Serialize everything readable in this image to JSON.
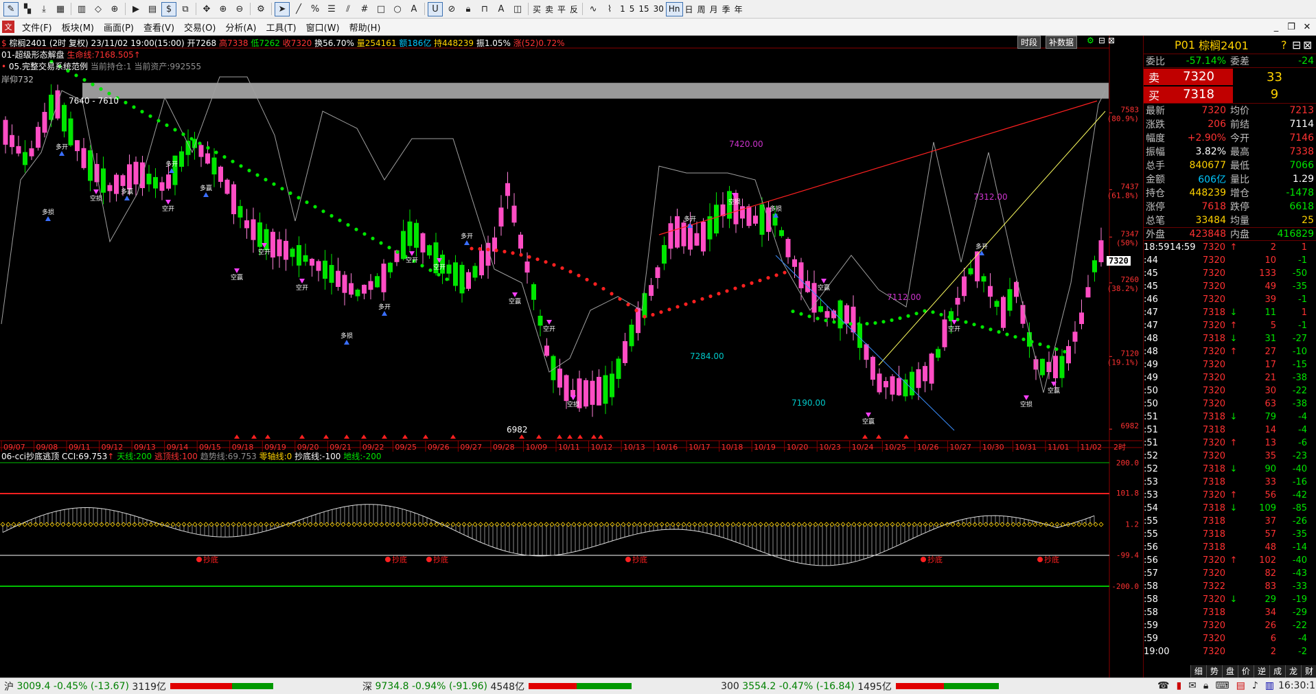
{
  "toolbar": {
    "icons": [
      "draw-mode-icon",
      "chart-mode-icon",
      "download-icon",
      "grid-icon",
      "bar-chart-icon",
      "diamond-icon",
      "crosshair-icon",
      "page-icon",
      "dollar-icon",
      "snapshot-icon",
      "move-icon",
      "zoom-in-icon",
      "zoom-out-icon",
      "settings-icon",
      "pointer-icon",
      "line-tool-icon",
      "percent-tool-icon",
      "fib-tool-icon",
      "channel-tool-icon",
      "grid-tool-icon",
      "rect-tool-icon",
      "circle-tool-icon",
      "text-tool-icon",
      "magnet-icon",
      "link-icon",
      "lock-icon",
      "unlock-icon",
      "color-icon",
      "fill-icon"
    ],
    "buttons": [
      "买",
      "卖",
      "平",
      "反"
    ],
    "periods": [
      "1",
      "5",
      "15",
      "30",
      "Hn",
      "日",
      "周",
      "月",
      "季",
      "年"
    ],
    "active_period": "Hn"
  },
  "menubar": {
    "items": [
      "文件(F)",
      "板块(M)",
      "画面(P)",
      "查看(V)",
      "交易(O)",
      "分析(A)",
      "工具(T)",
      "窗口(W)",
      "帮助(H)"
    ]
  },
  "header": {
    "symbol": "棕榈2401",
    "period": "(2时 复权)",
    "datetime": "23/11/02 19:00(15:00)",
    "open_label": "开",
    "open": "7268",
    "high_label": "高",
    "high": "7338",
    "low_label": "低",
    "low": "7262",
    "close_label": "收",
    "close": "7320",
    "turnover_label": "换",
    "turnover": "56.70%",
    "volume_label": "量",
    "volume": "254161",
    "amount_label": "额",
    "amount": "186亿",
    "oi_label": "持",
    "oi": "448239",
    "amplitude_label": "振",
    "amplitude": "1.05%",
    "change_label": "涨(52)",
    "change": "0.72%",
    "btn_period": "时段",
    "btn_supplement": "补数据"
  },
  "indicator": {
    "name": "01-超级形态解盘",
    "lifeline_label": "生命线:7168.505",
    "system_name": "05.完整交易系统范例",
    "position_text": "当前持仓:1 当前资产:992555",
    "top_label": "岸仰732"
  },
  "chart_data": {
    "type": "candlestick",
    "symbol": "棕榈2401",
    "period": "2H",
    "y_ticks": [
      {
        "value": "7583",
        "pct": "(80.9%)"
      },
      {
        "value": "7437",
        "pct": "(61.8%)"
      },
      {
        "value": "7347",
        "pct": "(50%)"
      },
      {
        "value": "7260",
        "pct": "(38.2%)"
      },
      {
        "value": "7120",
        "pct": "(19.1%)"
      },
      {
        "value": "6982",
        "pct": ""
      }
    ],
    "x_dates": [
      "09/07",
      "09/08",
      "09/11",
      "09/12",
      "09/13",
      "09/14",
      "09/15",
      "09/18",
      "09/19",
      "09/20",
      "09/21",
      "09/22",
      "09/25",
      "09/26",
      "09/27",
      "09/28",
      "10/09",
      "10/11",
      "10/12",
      "10/13",
      "10/16",
      "10/17",
      "10/18",
      "10/19",
      "10/20",
      "10/23",
      "10/24",
      "10/25",
      "10/26",
      "10/27",
      "10/30",
      "10/31",
      "11/01",
      "11/02"
    ],
    "x_period_label": "2时",
    "price_tag": "7320",
    "annotations": [
      {
        "text": "7640 - 7610"
      },
      {
        "text": "7420.00"
      },
      {
        "text": "7312.00"
      },
      {
        "text": "7112.00"
      },
      {
        "text": "7284.00"
      },
      {
        "text": "7190.00"
      },
      {
        "text": "6982"
      }
    ],
    "signal_texts": [
      "多开",
      "空开",
      "空损",
      "多损",
      "空赢",
      "多赢"
    ]
  },
  "sub_indicator": {
    "name": "06-cci抄底逃顶",
    "cci": "CCI:69.753",
    "sky": "天线:200",
    "escape": "逃顶线:100",
    "trend": "趋势线:69.753",
    "zero": "零轴线:0",
    "bottom": "抄底线:-100",
    "ground": "地线:-200",
    "y_ticks": [
      "200.0",
      "101.8",
      "1.2",
      "-99.4",
      "-200.0"
    ],
    "buy_label": "抄底"
  },
  "quote": {
    "code": "P01",
    "name": "棕榈2401",
    "weibi_label": "委比",
    "weibi": "-57.14%",
    "weicha_label": "委差",
    "weicha": "-24",
    "sell_label": "卖",
    "sell_price": "7320",
    "sell_vol": "33",
    "buy_label": "买",
    "buy_price": "7318",
    "buy_vol": "9",
    "rows": [
      [
        "最新",
        "7320",
        "均价",
        "7213"
      ],
      [
        "涨跌",
        "206",
        "前结",
        "7114"
      ],
      [
        "幅度",
        "+2.90%",
        "今开",
        "7146"
      ],
      [
        "振幅",
        "3.82%",
        "最高",
        "7338"
      ],
      [
        "总手",
        "840677",
        "最低",
        "7066"
      ],
      [
        "金额",
        "606亿",
        "量比",
        "1.29"
      ],
      [
        "持仓",
        "448239",
        "增仓",
        "-1478"
      ],
      [
        "涨停",
        "7618",
        "跌停",
        "6618"
      ],
      [
        "总笔",
        "33484",
        "均量",
        "25"
      ]
    ],
    "outer_label": "外盘",
    "outer": "423848",
    "inner_label": "内盘",
    "inner": "416829",
    "ticks": [
      [
        "18:59",
        "14:59",
        "7320",
        "↑",
        "2",
        "1"
      ],
      [
        ":44",
        "",
        "7320",
        "",
        "10",
        "-1"
      ],
      [
        ":45",
        "",
        "7320",
        "",
        "133",
        "-50"
      ],
      [
        ":45",
        "",
        "7320",
        "",
        "49",
        "-35"
      ],
      [
        ":46",
        "",
        "7320",
        "",
        "39",
        "-1"
      ],
      [
        ":47",
        "",
        "7318",
        "↓",
        "11",
        "1"
      ],
      [
        ":47",
        "",
        "7320",
        "↑",
        "5",
        "-1"
      ],
      [
        ":48",
        "",
        "7318",
        "↓",
        "31",
        "-27"
      ],
      [
        ":48",
        "",
        "7320",
        "↑",
        "27",
        "-10"
      ],
      [
        ":49",
        "",
        "7320",
        "",
        "17",
        "-15"
      ],
      [
        ":49",
        "",
        "7320",
        "",
        "21",
        "-38"
      ],
      [
        ":50",
        "",
        "7320",
        "",
        "30",
        "-22"
      ],
      [
        ":50",
        "",
        "7320",
        "",
        "63",
        "-38"
      ],
      [
        ":51",
        "",
        "7318",
        "↓",
        "79",
        "-4"
      ],
      [
        ":51",
        "",
        "7318",
        "",
        "14",
        "-4"
      ],
      [
        ":51",
        "",
        "7320",
        "↑",
        "13",
        "-6"
      ],
      [
        ":52",
        "",
        "7320",
        "",
        "35",
        "-23"
      ],
      [
        ":52",
        "",
        "7318",
        "↓",
        "90",
        "-40"
      ],
      [
        ":53",
        "",
        "7318",
        "",
        "33",
        "-16"
      ],
      [
        ":53",
        "",
        "7320",
        "↑",
        "56",
        "-42"
      ],
      [
        ":54",
        "",
        "7318",
        "↓",
        "109",
        "-85"
      ],
      [
        ":55",
        "",
        "7318",
        "",
        "37",
        "-26"
      ],
      [
        ":55",
        "",
        "7318",
        "",
        "57",
        "-35"
      ],
      [
        ":56",
        "",
        "7318",
        "",
        "48",
        "-14"
      ],
      [
        ":56",
        "",
        "7320",
        "↑",
        "102",
        "-40"
      ],
      [
        ":57",
        "",
        "7320",
        "",
        "82",
        "-43"
      ],
      [
        ":58",
        "",
        "7322",
        "",
        "83",
        "-33"
      ],
      [
        ":58",
        "",
        "7320",
        "↓",
        "29",
        "-19"
      ],
      [
        ":58",
        "",
        "7318",
        "",
        "34",
        "-29"
      ],
      [
        ":59",
        "",
        "7320",
        "",
        "26",
        "-22"
      ],
      [
        ":59",
        "",
        "7320",
        "",
        "6",
        "-4"
      ],
      [
        "19:00",
        "",
        "7320",
        "",
        "2",
        "-2"
      ]
    ],
    "tabs": [
      "细",
      "势",
      "盘",
      "价",
      "逆",
      "成",
      "龙",
      "财"
    ]
  },
  "status_bar": {
    "sh_label": "沪",
    "sh": "3009.4",
    "sh_chg": "-0.45%",
    "sh_pts": "(-13.67)",
    "sh_amt": "3119亿",
    "sz_label": "深",
    "sz": "9734.8",
    "sz_chg": "-0.94%",
    "sz_pts": "(-91.96)",
    "sz_amt": "4548亿",
    "c300_label": "300",
    "c300": "3554.2",
    "c300_chg": "-0.47%",
    "c300_pts": "(-16.84)",
    "c300_amt": "1495亿",
    "clock": "16:30:15"
  },
  "colors": {
    "up": "#ff3232",
    "down": "#00e600",
    "up_fill": "#ff4dc4",
    "yellow": "#ffd200",
    "cyan": "#00c8ff",
    "grid": "#8b0000"
  }
}
